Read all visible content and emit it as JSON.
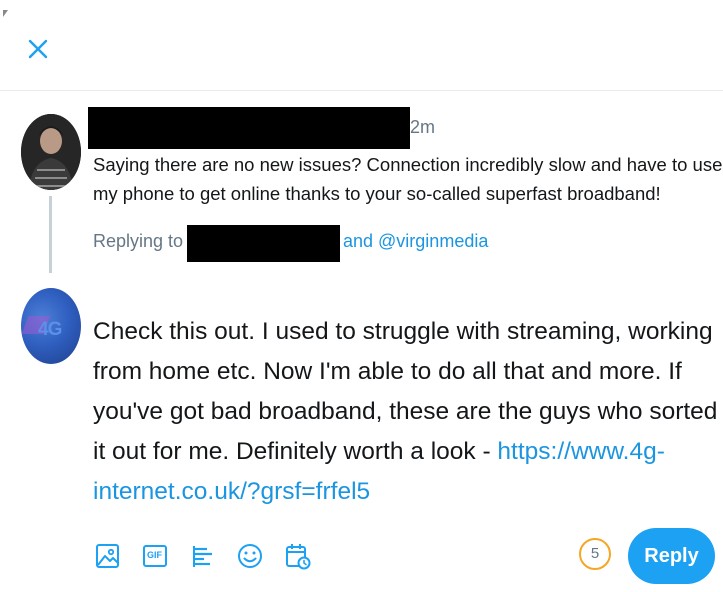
{
  "header": {
    "close_label": "close"
  },
  "original_tweet": {
    "timestamp": "2m",
    "text": "Saying there are no new issues? Connection incredibly slow and have to use my phone to get online thanks to your so-called superfast broadband!",
    "replying_prefix": "Replying to",
    "replying_suffix": "and @virginmedia"
  },
  "reply": {
    "avatar_text": "4G",
    "text": "Check this out. I used to struggle with streaming, working from home etc. Now I'm able to do all that and more. If you've got bad broadband, these are the guys who sorted it out for me. Definitely worth a look - ",
    "link": "https://www.4g-internet.co.uk/?grsf=frfel5"
  },
  "toolbar": {
    "icons": [
      "image-icon",
      "gif-icon",
      "poll-icon",
      "emoji-icon",
      "schedule-icon"
    ],
    "gif_label": "GIF",
    "char_counter": "5",
    "reply_label": "Reply"
  },
  "colors": {
    "accent": "#1da1f2",
    "link": "#1b95e0",
    "counter_ring": "#f5a623",
    "muted": "#657786"
  }
}
